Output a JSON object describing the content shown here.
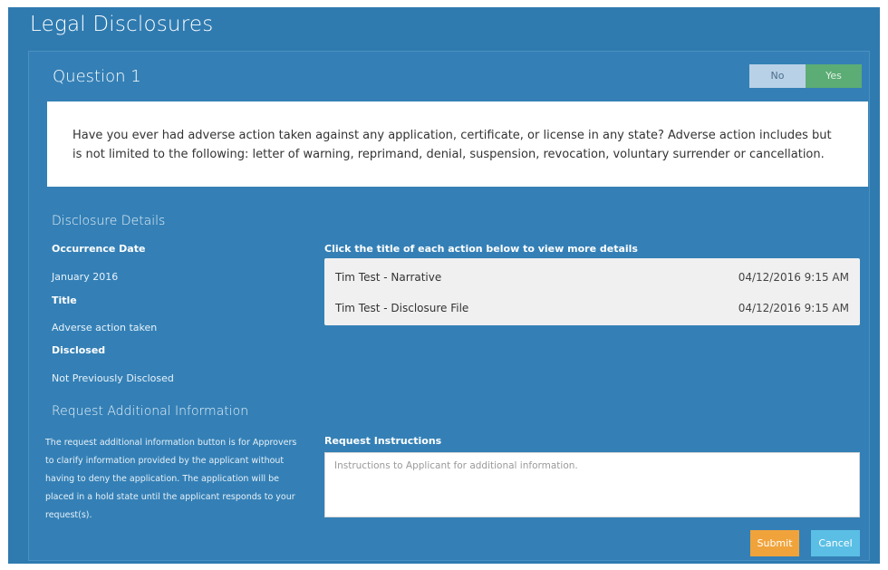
{
  "page": {
    "title": "Legal Disclosures"
  },
  "question": {
    "title": "Question 1",
    "toggle": {
      "no_label": "No",
      "yes_label": "Yes",
      "selected": "Yes"
    },
    "text": "Have you ever had adverse action taken against any application, certificate, or license in any state? Adverse action includes but is not limited to the following: letter of warning, reprimand, denial, suspension, revocation, voluntary surrender or cancellation."
  },
  "disclosure": {
    "heading": "Disclosure Details",
    "occurrence_label": "Occurrence Date",
    "occurrence_value": "January 2016",
    "title_label": "Title",
    "title_value": "Adverse action taken",
    "disclosed_label": "Disclosed",
    "disclosed_value": "Not Previously Disclosed"
  },
  "actions": {
    "heading": "Click the title of each action below to view more details",
    "items": [
      {
        "title": "Tim Test - Narrative",
        "date": "04/12/2016 9:15 AM"
      },
      {
        "title": "Tim Test - Disclosure File",
        "date": "04/12/2016 9:15 AM"
      }
    ]
  },
  "request": {
    "heading": "Request Additional Information",
    "help_text": "The request additional information button is for Approvers to clarify information provided by the applicant without having to deny the application. The application will be placed in a hold state until the applicant responds to your request(s).",
    "instructions_label": "Request Instructions",
    "instructions_placeholder": "Instructions to Applicant for additional information.",
    "instructions_value": "",
    "submit_label": "Submit",
    "cancel_label": "Cancel"
  },
  "colors": {
    "panel_bg": "#2f7bb0",
    "toggle_yes": "#5cac75",
    "toggle_no": "#b9d1e6",
    "submit": "#f0a33a",
    "cancel": "#5bbfe5"
  }
}
